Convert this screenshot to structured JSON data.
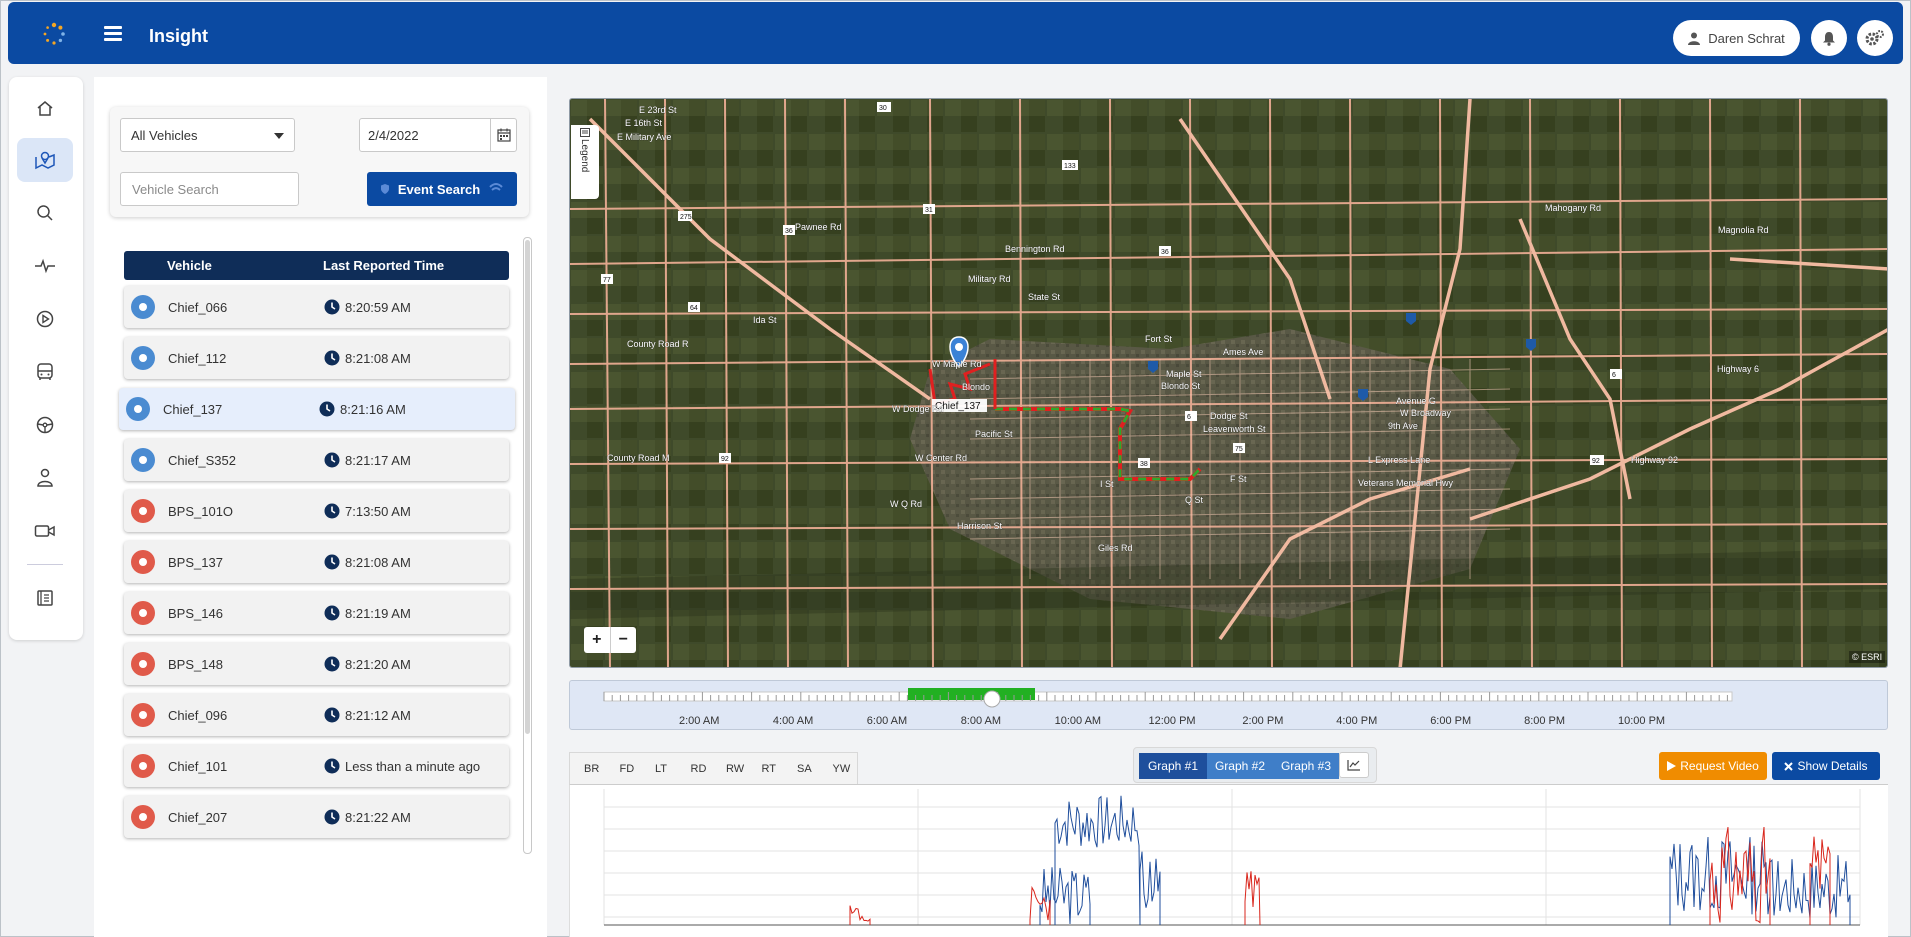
{
  "app": {
    "title": "Insight"
  },
  "header": {
    "user_name": "Daren Schrat"
  },
  "filters": {
    "vehicle_select": "All Vehicles",
    "date": "2/4/2022",
    "search_placeholder": "Vehicle Search",
    "event_search_label": "Event Search"
  },
  "table": {
    "col_vehicle": "Vehicle",
    "col_time": "Last Reported Time",
    "rows": [
      {
        "name": "Chief_066",
        "time": "8:20:59 AM",
        "status": "blue"
      },
      {
        "name": "Chief_112",
        "time": "8:21:08 AM",
        "status": "blue"
      },
      {
        "name": "Chief_137",
        "time": "8:21:16 AM",
        "status": "blue"
      },
      {
        "name": "Chief_S352",
        "time": "8:21:17 AM",
        "status": "blue"
      },
      {
        "name": "BPS_101O",
        "time": "7:13:50 AM",
        "status": "red"
      },
      {
        "name": "BPS_137",
        "time": "8:21:08 AM",
        "status": "red"
      },
      {
        "name": "BPS_146",
        "time": "8:21:19 AM",
        "status": "red"
      },
      {
        "name": "BPS_148",
        "time": "8:21:20 AM",
        "status": "red"
      },
      {
        "name": "Chief_096",
        "time": "8:21:12 AM",
        "status": "red"
      },
      {
        "name": "Chief_101",
        "time": "Less than a minute ago",
        "status": "red"
      },
      {
        "name": "Chief_207",
        "time": "8:21:22 AM",
        "status": "red"
      }
    ]
  },
  "map": {
    "legend_label": "Legend",
    "zoom_in": "+",
    "zoom_out": "−",
    "attribution": "© ESRI",
    "labels": {
      "a": "Military Rd",
      "b": "State St",
      "c": "Bennington Rd",
      "d": "Pawnee Rd",
      "e": "County Road R",
      "f": "Ida St",
      "g": "W Maple Rd",
      "h": "W Dodge Rd",
      "i": "Pacific St",
      "j": "W Center Rd",
      "k": "County Road M",
      "l": "W Q Rd",
      "m": "Harrison St",
      "n": "Giles Rd",
      "o": "Dodge St",
      "p": "Leavenworth St",
      "q": "Ames Ave",
      "r": "Highway 6",
      "s": "Highway 92",
      "t": "L Express Lane",
      "u": "Veterans Memorial Hwy",
      "v": "Mahogany Rd",
      "w": "Magnolia Rd",
      "x": "Avenue G",
      "y": "W Broadway",
      "z": "9th Ave",
      "aa": "Fort St",
      "ab": "Blondo St",
      "ac": "Maple St",
      "ad": "Q St",
      "ae": "I St",
      "af": "F St",
      "ag": "E 23rd St",
      "ah": "E 16th St",
      "ai": "E Military Ave",
      "aj": "Blondo",
      "ak": "Chief_137"
    },
    "route_colors": {
      "route": "#2ea82e",
      "event": "#e02020"
    },
    "marker_color": "#3b82d6"
  },
  "timeline": {
    "ticks": [
      "2:00 AM",
      "4:00 AM",
      "6:00 AM",
      "8:00 AM",
      "10:00 AM",
      "12:00 PM",
      "2:00 PM",
      "4:00 PM",
      "6:00 PM",
      "8:00 PM",
      "10:00 PM"
    ],
    "active_color": "#22b022"
  },
  "graph": {
    "tabs": [
      "BR",
      "FD",
      "LT",
      "RD",
      "RW",
      "RT",
      "SA",
      "YW"
    ],
    "buttons": [
      "Graph #1",
      "Graph #2",
      "Graph #3"
    ],
    "request_video": "Request Video",
    "show_details": "Show Details",
    "series_colors": {
      "primary": "#1f4e9c",
      "secondary": "#d9261c"
    }
  },
  "icons": {
    "rail": [
      "home-icon",
      "map-icon",
      "search-icon",
      "activity-icon",
      "play-icon",
      "bus-icon",
      "steering-wheel-icon",
      "driver-icon",
      "video-camera-icon",
      "report-icon"
    ]
  }
}
